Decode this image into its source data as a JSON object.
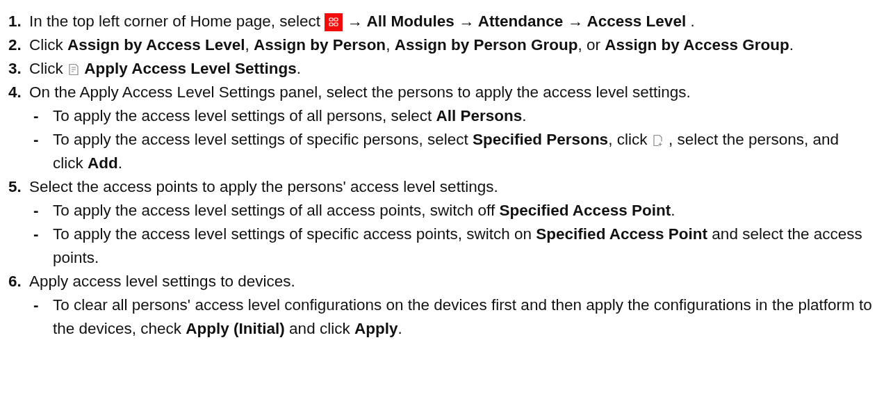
{
  "steps": [
    {
      "number": "1.",
      "parts": [
        {
          "kind": "text",
          "text": "In the top left corner of Home page, select "
        },
        {
          "kind": "grid-icon"
        },
        {
          "kind": "text",
          "text": " **→ All Modules → Attendance → Access Level** ."
        }
      ]
    },
    {
      "number": "2.",
      "parts": [
        {
          "kind": "text",
          "text": "Click **Assign by Access Level**, **Assign by Person**, **Assign by Person Group**, or **Assign by Access Group**."
        }
      ]
    },
    {
      "number": "3.",
      "parts": [
        {
          "kind": "text",
          "text": "Click "
        },
        {
          "kind": "doc-icon"
        },
        {
          "kind": "text",
          "text": " **Apply Access Level Settings**."
        }
      ]
    },
    {
      "number": "4.",
      "parts": [
        {
          "kind": "text",
          "text": "On the Apply Access Level Settings panel, select the persons to apply the access level settings."
        }
      ],
      "bullets": [
        {
          "marker": "-",
          "parts": [
            {
              "kind": "text",
              "text": "To apply the access level settings of all persons, select **All Persons**."
            }
          ]
        },
        {
          "marker": "-",
          "parts": [
            {
              "kind": "text",
              "text": "To apply the access level settings of specific persons, select **Specified Persons**, click "
            },
            {
              "kind": "add-file-icon"
            },
            {
              "kind": "text",
              "text": " , select the persons, and click **Add**."
            }
          ]
        }
      ]
    },
    {
      "number": "5.",
      "parts": [
        {
          "kind": "text",
          "text": "Select the access points to apply the persons' access level settings."
        }
      ],
      "bullets": [
        {
          "marker": "-",
          "parts": [
            {
              "kind": "text",
              "text": "To apply the access level settings of all access points, switch off **Specified Access Point**."
            }
          ]
        },
        {
          "marker": "-",
          "parts": [
            {
              "kind": "text",
              "text": "To apply the access level settings of specific access points, switch on **Specified Access Point** and select the access points."
            }
          ]
        }
      ]
    },
    {
      "number": "6.",
      "parts": [
        {
          "kind": "text",
          "text": "Apply access level settings to devices."
        }
      ],
      "bullets": [
        {
          "marker": "-",
          "parts": [
            {
              "kind": "text",
              "text": "To clear all persons' access level configurations on the devices first and then apply the configurations in the platform to the devices, check **Apply (Initial)** and click **Apply**."
            }
          ]
        }
      ]
    }
  ]
}
